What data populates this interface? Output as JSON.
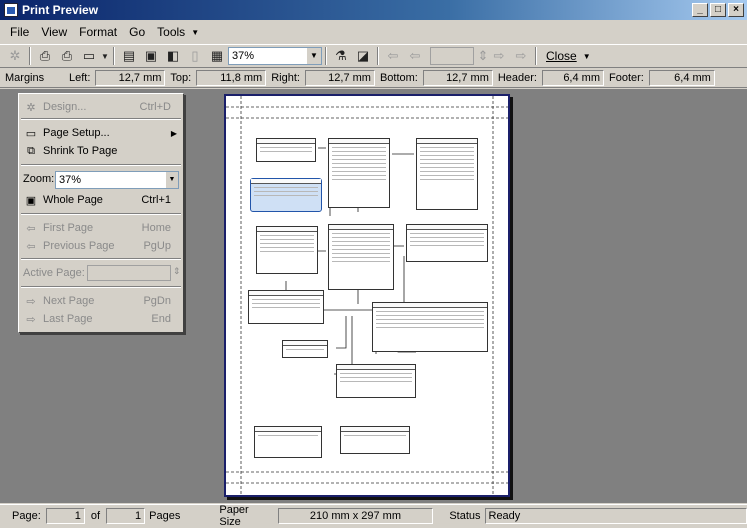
{
  "window": {
    "title": "Print Preview"
  },
  "menubar": {
    "items": [
      "File",
      "View",
      "Format",
      "Go",
      "Tools"
    ]
  },
  "toolbar": {
    "zoom_value": "37%",
    "close_label": "Close"
  },
  "margins": {
    "label": "Margins",
    "left": {
      "label": "Left:",
      "value": "12,7 mm"
    },
    "top": {
      "label": "Top:",
      "value": "11,8 mm"
    },
    "right": {
      "label": "Right:",
      "value": "12,7 mm"
    },
    "bottom": {
      "label": "Bottom:",
      "value": "12,7 mm"
    },
    "header": {
      "label": "Header:",
      "value": "6,4 mm"
    },
    "footer": {
      "label": "Footer:",
      "value": "6,4 mm"
    }
  },
  "gomenu": {
    "design": {
      "label": "Design...",
      "shortcut": "Ctrl+D"
    },
    "page_setup": {
      "label": "Page Setup..."
    },
    "shrink": {
      "label": "Shrink To Page"
    },
    "zoom": {
      "label": "Zoom:",
      "value": "37%"
    },
    "whole_page": {
      "label": "Whole Page",
      "shortcut": "Ctrl+1"
    },
    "first_page": {
      "label": "First Page",
      "shortcut": "Home"
    },
    "previous_page": {
      "label": "Previous Page",
      "shortcut": "PgUp"
    },
    "active_page": {
      "label": "Active Page:"
    },
    "next_page": {
      "label": "Next Page",
      "shortcut": "PgDn"
    },
    "last_page": {
      "label": "Last Page",
      "shortcut": "End"
    }
  },
  "status": {
    "page_label": "Page:",
    "page_value": "1",
    "of_label": "of",
    "pages_value": "1",
    "pages_label": "Pages",
    "paper_label": "Paper Size",
    "paper_value": "210 mm x 297 mm",
    "status_label": "Status",
    "status_value": "Ready"
  }
}
